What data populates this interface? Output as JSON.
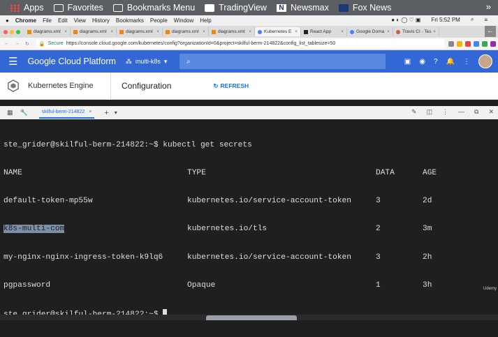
{
  "bookmarks": [
    {
      "label": "Apps",
      "icon": "apps-grid-icon"
    },
    {
      "label": "Favorites",
      "icon": "folder-icon"
    },
    {
      "label": "Bookmarks Menu",
      "icon": "folder-icon"
    },
    {
      "label": "TradingView",
      "icon": "tradingview-icon"
    },
    {
      "label": "Newsmax",
      "icon": "newsmax-icon"
    },
    {
      "label": "Fox News",
      "icon": "fox-news-icon"
    }
  ],
  "mac_menu": {
    "app": "Chrome",
    "items": [
      "File",
      "Edit",
      "View",
      "History",
      "Bookmarks",
      "People",
      "Window",
      "Help"
    ],
    "clock": "Fri 5:52 PM"
  },
  "tabs": [
    {
      "label": "diagrams.xml"
    },
    {
      "label": "diagrams.xml"
    },
    {
      "label": "diagrams.xml"
    },
    {
      "label": "diagrams.xml"
    },
    {
      "label": "diagrams.xml"
    },
    {
      "label": "Kubernetes E"
    },
    {
      "label": "React App"
    },
    {
      "label": "Google Doma"
    },
    {
      "label": "Travis CI - Tes"
    }
  ],
  "address": {
    "secure": "Secure",
    "url": "https://console.cloud.google.com/kubernetes/config?organizationId=0&project=skilful-berm-214822&config_list_tablesize=50"
  },
  "gcp": {
    "title": "Google Cloud Platform",
    "project": "multi-k8s"
  },
  "k8s": {
    "title": "Kubernetes Engine",
    "page": "Configuration",
    "refresh": "REFRESH"
  },
  "shell": {
    "tab_label": "skilful-berm-214822"
  },
  "terminal": {
    "prompt1": "ste_grider@skilful-berm-214822:~$ kubectl get secrets",
    "headers": [
      "NAME",
      "TYPE",
      "DATA",
      "AGE"
    ],
    "rows": [
      [
        "default-token-mp55w",
        "kubernetes.io/service-account-token",
        "3",
        "2d"
      ],
      [
        "k8s-multi-com",
        "kubernetes.io/tls",
        "2",
        "3m"
      ],
      [
        "my-nginx-nginx-ingress-token-k9lq6",
        "kubernetes.io/service-account-token",
        "3",
        "2h"
      ],
      [
        "pgpassword",
        "Opaque",
        "1",
        "3h"
      ]
    ],
    "prompt2": "ste_grider@skilful-berm-214822:~$ "
  },
  "watermark": "Udemy"
}
